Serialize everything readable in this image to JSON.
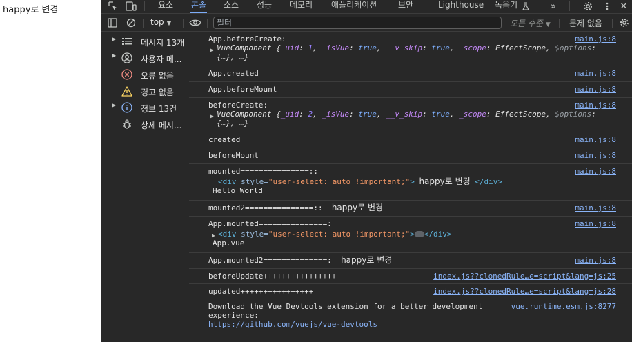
{
  "page": {
    "text": "happy로 변경"
  },
  "devtools": {
    "tabs": [
      "요소",
      "콘솔",
      "소스",
      "성능",
      "메모리",
      "애플리케이션",
      "보안",
      "Lighthouse",
      "녹음기"
    ],
    "active_tab": "콘솔",
    "toolbar": {
      "context": "top",
      "filter_placeholder": "필터",
      "levels": "모든 수준",
      "issues": "문제 없음"
    },
    "sidebar": [
      {
        "label": "메시지 13개",
        "icon": "list-icon"
      },
      {
        "label": "사용자 메...",
        "icon": "user-icon"
      },
      {
        "label": "오류 없음",
        "icon": "error-icon"
      },
      {
        "label": "경고 없음",
        "icon": "warning-icon"
      },
      {
        "label": "정보 13건",
        "icon": "info-icon"
      },
      {
        "label": "상세 메시...",
        "icon": "bug-icon"
      }
    ],
    "messages": [
      {
        "text": "App.beforeCreate:",
        "source": "main.js:8",
        "obj": {
          "name": "VueComponent",
          "uid_key": "_uid",
          "uid": "1",
          "isvue_key": "_isVue",
          "isvue": "true",
          "skip_key": "__v_skip",
          "skip": "true",
          "scope_key": "_scope",
          "scope": "EffectScope",
          "options_key": "$options",
          "tail": "{…}, …}"
        }
      },
      {
        "text": "App.created",
        "source": "main.js:8"
      },
      {
        "text": "App.beforeMount",
        "source": "main.js:8"
      },
      {
        "text": "beforeCreate:",
        "source": "main.js:8",
        "obj": {
          "name": "VueComponent",
          "uid_key": "_uid",
          "uid": "2",
          "isvue_key": "_isVue",
          "isvue": "true",
          "skip_key": "__v_skip",
          "skip": "true",
          "scope_key": "_scope",
          "scope": "EffectScope",
          "options_key": "$options",
          "tail": "{…}, …}"
        }
      },
      {
        "text": "created",
        "source": "main.js:8"
      },
      {
        "text": "beforeMount",
        "source": "main.js:8"
      },
      {
        "text": "mounted===============::",
        "source": "main.js:8",
        "el": {
          "open": "<div",
          "attr": "style",
          "val": "\"user-select: auto !important;\"",
          "close": ">",
          "content": "happy로 변경",
          "end": "</div>"
        },
        "extra": "Hello World"
      },
      {
        "text": "mounted2===============::",
        "value": "happy로 변경",
        "source": "main.js:8"
      },
      {
        "text": "App.mounted===============:",
        "source": "main.js:8",
        "el": {
          "open": "<div",
          "attr": "style",
          "val": "\"user-select: auto !important;\"",
          "close": ">",
          "end": "</div>"
        },
        "extra": "App.vue"
      },
      {
        "text": "App.mounted2==============:",
        "value": "happy로 변경",
        "source": "main.js:8"
      },
      {
        "text": "beforeUpdate++++++++++++++++",
        "source": "index.js??clonedRule…e=script&lang=js:25"
      },
      {
        "text": "updated++++++++++++++++",
        "source": "index.js??clonedRule…e=script&lang=js:28"
      },
      {
        "text": "Download the Vue Devtools extension for a better development",
        "text2": "experience:",
        "link": "https://github.com/vuejs/vue-devtools",
        "source": "vue.runtime.esm.js:8277"
      }
    ]
  }
}
